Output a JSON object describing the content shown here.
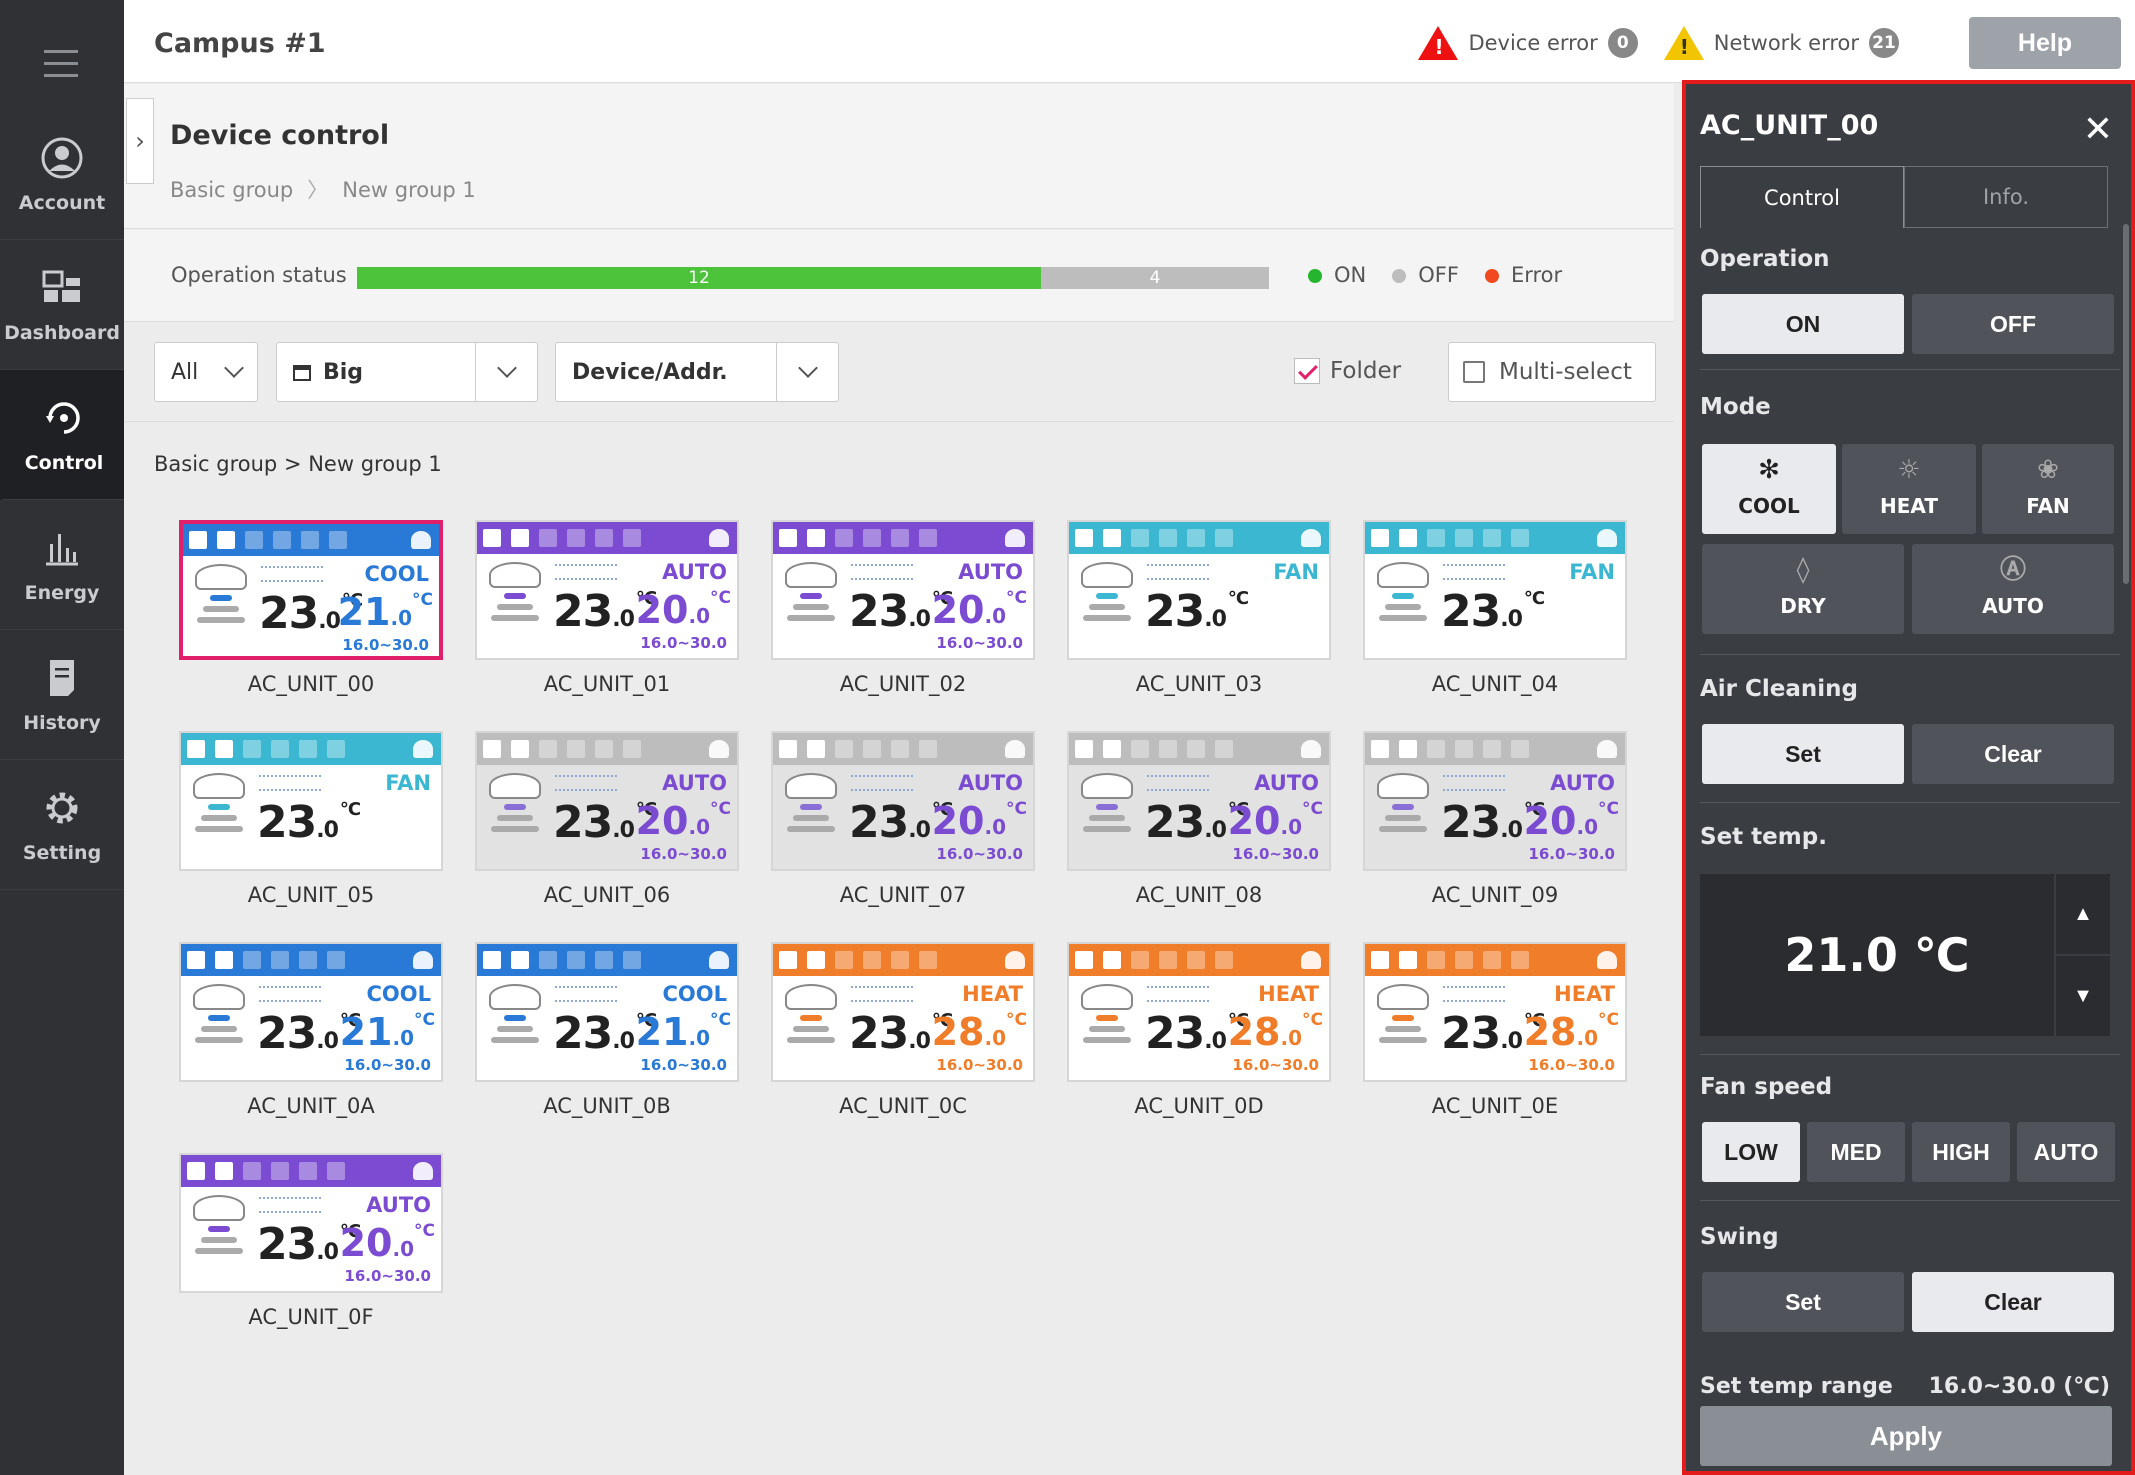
{
  "header": {
    "title": "Campus #1",
    "device_error_label": "Device error",
    "device_error_count": "0",
    "network_error_label": "Network error",
    "network_error_count": "21",
    "help_label": "Help"
  },
  "nav": {
    "items": [
      {
        "label": "Account"
      },
      {
        "label": "Dashboard"
      },
      {
        "label": "Control"
      },
      {
        "label": "Energy"
      },
      {
        "label": "History"
      },
      {
        "label": "Setting"
      }
    ],
    "active": "Control"
  },
  "page": {
    "title": "Device control",
    "crumb_root": "Basic group",
    "crumb_leaf": "New group 1",
    "grid_crumb": "Basic group > New group 1"
  },
  "operation": {
    "label": "Operation status",
    "on_count": "12",
    "off_count": "4",
    "on_fraction": 0.75,
    "legend_on": "ON",
    "legend_off": "OFF",
    "legend_error": "Error"
  },
  "filters": {
    "all": "All",
    "size": "Big",
    "sort": "Device/Addr.",
    "folder_label": "Folder",
    "folder_checked": true,
    "multi_label": "Multi-select"
  },
  "units": [
    {
      "name": "AC_UNIT_00",
      "mode": "COOL",
      "cur": "23",
      "set": "21",
      "range": "16.0~30.0",
      "state": "on",
      "selected": true
    },
    {
      "name": "AC_UNIT_01",
      "mode": "AUTO",
      "cur": "23",
      "set": "20",
      "range": "16.0~30.0",
      "state": "on"
    },
    {
      "name": "AC_UNIT_02",
      "mode": "AUTO",
      "cur": "23",
      "set": "20",
      "range": "16.0~30.0",
      "state": "on"
    },
    {
      "name": "AC_UNIT_03",
      "mode": "FAN",
      "cur": "23",
      "set": "",
      "range": "",
      "state": "on"
    },
    {
      "name": "AC_UNIT_04",
      "mode": "FAN",
      "cur": "23",
      "set": "",
      "range": "",
      "state": "on"
    },
    {
      "name": "AC_UNIT_05",
      "mode": "FAN",
      "cur": "23",
      "set": "",
      "range": "",
      "state": "on"
    },
    {
      "name": "AC_UNIT_06",
      "mode": "AUTO",
      "cur": "23",
      "set": "20",
      "range": "16.0~30.0",
      "state": "off"
    },
    {
      "name": "AC_UNIT_07",
      "mode": "AUTO",
      "cur": "23",
      "set": "20",
      "range": "16.0~30.0",
      "state": "off"
    },
    {
      "name": "AC_UNIT_08",
      "mode": "AUTO",
      "cur": "23",
      "set": "20",
      "range": "16.0~30.0",
      "state": "off"
    },
    {
      "name": "AC_UNIT_09",
      "mode": "AUTO",
      "cur": "23",
      "set": "20",
      "range": "16.0~30.0",
      "state": "off"
    },
    {
      "name": "AC_UNIT_0A",
      "mode": "COOL",
      "cur": "23",
      "set": "21",
      "range": "16.0~30.0",
      "state": "on"
    },
    {
      "name": "AC_UNIT_0B",
      "mode": "COOL",
      "cur": "23",
      "set": "21",
      "range": "16.0~30.0",
      "state": "on"
    },
    {
      "name": "AC_UNIT_0C",
      "mode": "HEAT",
      "cur": "23",
      "set": "28",
      "range": "16.0~30.0",
      "state": "on"
    },
    {
      "name": "AC_UNIT_0D",
      "mode": "HEAT",
      "cur": "23",
      "set": "28",
      "range": "16.0~30.0",
      "state": "on"
    },
    {
      "name": "AC_UNIT_0E",
      "mode": "HEAT",
      "cur": "23",
      "set": "28",
      "range": "16.0~30.0",
      "state": "on"
    },
    {
      "name": "AC_UNIT_0F",
      "mode": "AUTO",
      "cur": "23",
      "set": "20",
      "range": "16.0~30.0",
      "state": "on"
    }
  ],
  "mode_colors": {
    "COOL": "#2979d6",
    "AUTO": "#7b4cd1",
    "FAN": "#3bb7d2",
    "HEAT": "#f07d2a",
    "OFF": "#bdbdbd"
  },
  "temp_suffix": {
    "decimal": ".0",
    "unit": "°C"
  },
  "panel": {
    "title": "AC_UNIT_00",
    "tab_control": "Control",
    "tab_info": "Info.",
    "operation_label": "Operation",
    "on": "ON",
    "off": "OFF",
    "mode_label": "Mode",
    "modes": [
      "COOL",
      "HEAT",
      "FAN",
      "DRY",
      "AUTO"
    ],
    "mode_selected": "COOL",
    "air_cleaning_label": "Air Cleaning",
    "ac_set": "Set",
    "ac_clear": "Clear",
    "set_temp_label": "Set temp.",
    "set_temp_value": "21.0 ℃",
    "fan_speed_label": "Fan speed",
    "fan_speeds": [
      "LOW",
      "MED",
      "HIGH",
      "AUTO"
    ],
    "fan_selected": "LOW",
    "swing_label": "Swing",
    "swing_set": "Set",
    "swing_clear": "Clear",
    "swing_selected": "Clear",
    "range_label": "Set temp range",
    "range_value": "16.0~30.0 (℃)",
    "apply": "Apply"
  }
}
